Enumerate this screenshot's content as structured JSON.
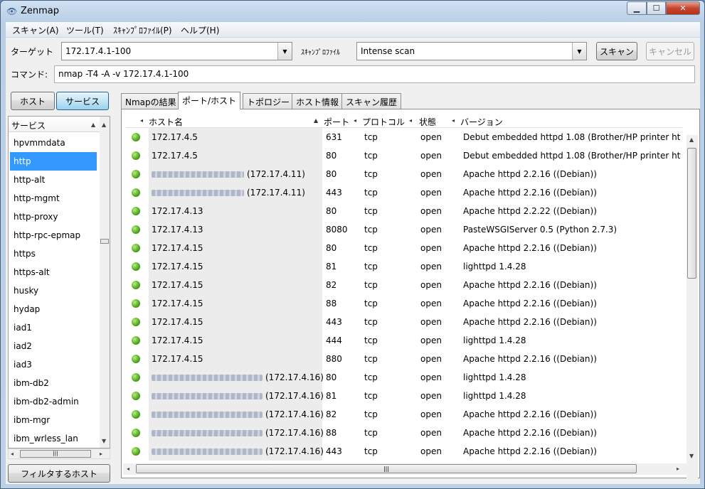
{
  "window": {
    "title": "Zenmap",
    "minimize": "▁",
    "maximize": "☐",
    "close": "✕"
  },
  "menu": [
    "スキャン(A)",
    "ツール(T)",
    "ｽｷｬﾝﾌﾟﾛﾌｧｲﾙ(P)",
    "ヘルプ(H)"
  ],
  "toolbar": {
    "target_label": "ターゲット",
    "target_value": "172.17.4.1-100",
    "profile_label": "ｽｷｬﾝﾌﾟﾛﾌｧｲﾙ",
    "profile_value": "Intense scan",
    "scan_button": "スキャン",
    "cancel_button": "キャンセル",
    "command_label": "コマンド:",
    "command_value": "nmap -T4 -A -v 172.17.4.1-100"
  },
  "left": {
    "host_button": "ホスト",
    "service_button": "サービス",
    "list_header": "サービス",
    "services": [
      "hpvmmdata",
      "http",
      "http-alt",
      "http-mgmt",
      "http-proxy",
      "http-rpc-epmap",
      "https",
      "https-alt",
      "husky",
      "hydap",
      "iad1",
      "iad2",
      "iad3",
      "ibm-db2",
      "ibm-db2-admin",
      "ibm-mgr",
      "ibm_wrless_lan"
    ],
    "selected_index": 1,
    "filter_button": "フィルタするホスト"
  },
  "tabs": [
    "Nmapの結果",
    "ポート/ホスト",
    "トポロジー",
    "ホスト情報",
    "スキャン履歴"
  ],
  "active_tab": 1,
  "table": {
    "headers": {
      "host": "ホスト名",
      "port": "ポート",
      "protocol": "プロトコル",
      "state": "状態",
      "version": "バージョン"
    },
    "rows": [
      {
        "host": "172.17.4.5",
        "port": "631",
        "protocol": "tcp",
        "state": "open",
        "version": "Debut embedded httpd 1.08 (Brother/HP printer http"
      },
      {
        "host": "172.17.4.5",
        "port": "80",
        "protocol": "tcp",
        "state": "open",
        "version": "Debut embedded httpd 1.08 (Brother/HP printer http"
      },
      {
        "host": "(172.17.4.11)",
        "port": "80",
        "protocol": "tcp",
        "state": "open",
        "version": "Apache httpd 2.2.16 ((Debian))"
      },
      {
        "host": "(172.17.4.11)",
        "port": "443",
        "protocol": "tcp",
        "state": "open",
        "version": "Apache httpd 2.2.16 ((Debian))"
      },
      {
        "host": "172.17.4.13",
        "port": "80",
        "protocol": "tcp",
        "state": "open",
        "version": "Apache httpd 2.2.22 ((Debian))"
      },
      {
        "host": "172.17.4.13",
        "port": "8080",
        "protocol": "tcp",
        "state": "open",
        "version": "PasteWSGIServer 0.5 (Python 2.7.3)"
      },
      {
        "host": "172.17.4.15",
        "port": "80",
        "protocol": "tcp",
        "state": "open",
        "version": "Apache httpd 2.2.16 ((Debian))"
      },
      {
        "host": "172.17.4.15",
        "port": "81",
        "protocol": "tcp",
        "state": "open",
        "version": "lighttpd 1.4.28"
      },
      {
        "host": "172.17.4.15",
        "port": "82",
        "protocol": "tcp",
        "state": "open",
        "version": "Apache httpd 2.2.16 ((Debian))"
      },
      {
        "host": "172.17.4.15",
        "port": "88",
        "protocol": "tcp",
        "state": "open",
        "version": "Apache httpd 2.2.16 ((Debian))"
      },
      {
        "host": "172.17.4.15",
        "port": "443",
        "protocol": "tcp",
        "state": "open",
        "version": "Apache httpd 2.2.16 ((Debian))"
      },
      {
        "host": "172.17.4.15",
        "port": "444",
        "protocol": "tcp",
        "state": "open",
        "version": "lighttpd 1.4.28"
      },
      {
        "host": "172.17.4.15",
        "port": "880",
        "protocol": "tcp",
        "state": "open",
        "version": "Apache httpd 2.2.16 ((Debian))"
      },
      {
        "host": "(172.17.4.16)",
        "port": "80",
        "protocol": "tcp",
        "state": "open",
        "version": "lighttpd 1.4.28"
      },
      {
        "host": "(172.17.4.16)",
        "port": "81",
        "protocol": "tcp",
        "state": "open",
        "version": "lighttpd 1.4.28"
      },
      {
        "host": "(172.17.4.16)",
        "port": "82",
        "protocol": "tcp",
        "state": "open",
        "version": "Apache httpd 2.2.16 ((Debian))"
      },
      {
        "host": "(172.17.4.16)",
        "port": "88",
        "protocol": "tcp",
        "state": "open",
        "version": "Apache httpd 2.2.16 ((Debian))"
      },
      {
        "host": "(172.17.4.16)",
        "port": "443",
        "protocol": "tcp",
        "state": "open",
        "version": "Apache httpd 2.2.16 ((Debian))"
      }
    ]
  },
  "icons": {
    "status": "host-up-icon",
    "scroll_grip": "|||"
  }
}
